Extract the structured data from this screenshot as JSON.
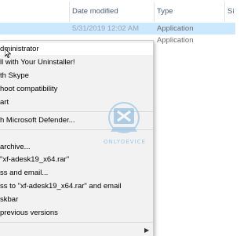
{
  "header": {
    "date_modified": "Date modified",
    "type": "Type",
    "size": "Si"
  },
  "rows": [
    {
      "date": "5/31/2019 12:02 AM",
      "type": "Application"
    },
    {
      "date": "",
      "type": "Application"
    }
  ],
  "context_menu": {
    "items": [
      {
        "label": "dministrator"
      },
      {
        "label": "ll with Your Uninstaller!"
      },
      {
        "label": "th Skype"
      },
      {
        "label": "hoot compatibility"
      },
      {
        "label": "art"
      },
      {
        "label": "h Microsoft Defender..."
      },
      {
        "label": "archive..."
      },
      {
        "label": "\"xf-adesk19_x64.rar\""
      },
      {
        "label": "ss and email..."
      },
      {
        "label": "ss to \"xf-adesk19_x64.rar\" and email"
      },
      {
        "label": "skbar"
      },
      {
        "label": "previous versions"
      },
      {
        "label": ""
      }
    ]
  },
  "watermark": {
    "text": "ONLYDEVICE"
  },
  "colors": {
    "selection": "#cce8ff",
    "menu_bg": "#f2f2f2",
    "header_text": "#4c607a"
  }
}
